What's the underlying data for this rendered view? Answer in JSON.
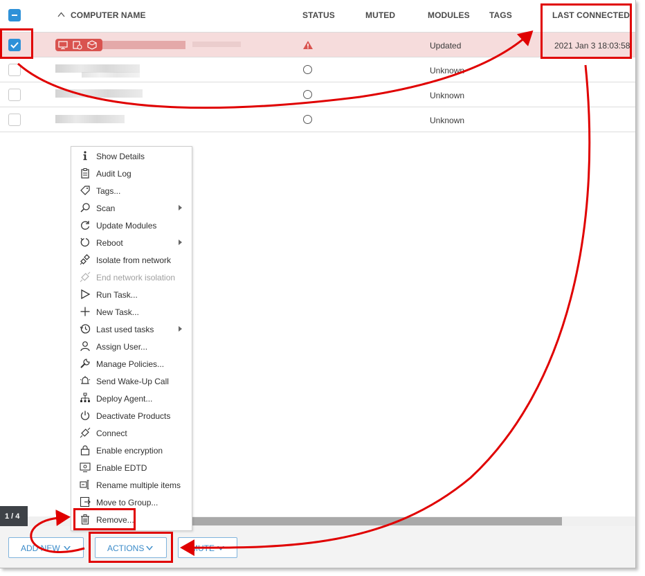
{
  "header": {
    "computer_name": "COMPUTER NAME",
    "status": "STATUS",
    "muted": "MUTED",
    "modules": "MODULES",
    "tags": "TAGS",
    "last_connected": "LAST CONNECTED"
  },
  "rows": [
    {
      "selected": true,
      "status_icon": "warning-icon",
      "modules": "Updated",
      "last_connected": "2021 Jan 3 18:03:58"
    },
    {
      "selected": false,
      "status_icon": "circle-icon",
      "modules": "Unknown",
      "last_connected": ""
    },
    {
      "selected": false,
      "status_icon": "circle-icon",
      "modules": "Unknown",
      "last_connected": ""
    },
    {
      "selected": false,
      "status_icon": "circle-icon",
      "modules": "Unknown",
      "last_connected": ""
    }
  ],
  "menu": {
    "items": [
      {
        "label": "Show Details",
        "icon": "info-icon"
      },
      {
        "label": "Audit Log",
        "icon": "clipboard-icon"
      },
      {
        "label": "Tags...",
        "icon": "tag-icon"
      },
      {
        "label": "Scan",
        "icon": "search-icon",
        "submenu": true
      },
      {
        "label": "Update Modules",
        "icon": "refresh-icon"
      },
      {
        "label": "Reboot",
        "icon": "reboot-icon",
        "submenu": true
      },
      {
        "label": "Isolate from network",
        "icon": "unplug-icon"
      },
      {
        "label": "End network isolation",
        "icon": "plug-icon",
        "disabled": true
      },
      {
        "label": "Run Task...",
        "icon": "play-icon"
      },
      {
        "label": "New Task...",
        "icon": "plus-icon"
      },
      {
        "label": "Last used tasks",
        "icon": "history-icon",
        "submenu": true
      },
      {
        "label": "Assign User...",
        "icon": "user-icon"
      },
      {
        "label": "Manage Policies...",
        "icon": "wrench-icon"
      },
      {
        "label": "Send Wake-Up Call",
        "icon": "bell-icon"
      },
      {
        "label": "Deploy Agent...",
        "icon": "network-icon"
      },
      {
        "label": "Deactivate Products",
        "icon": "power-icon"
      },
      {
        "label": "Connect",
        "icon": "connect-icon"
      },
      {
        "label": "Enable encryption",
        "icon": "lock-icon"
      },
      {
        "label": "Enable EDTD",
        "icon": "monitor-icon"
      },
      {
        "label": "Rename multiple items",
        "icon": "rename-icon"
      },
      {
        "label": "Move to Group...",
        "icon": "move-icon"
      },
      {
        "label": "Remove...",
        "icon": "trash-icon"
      }
    ]
  },
  "pager": "1 / 4",
  "buttons": {
    "add_new": "ADD NEW",
    "actions": "ACTIONS",
    "mute": "MUTE"
  },
  "colors": {
    "accent": "#2e91d8",
    "selected_row": "#f6dcdc",
    "warning": "#d9534f",
    "annotation": "#e00000"
  }
}
